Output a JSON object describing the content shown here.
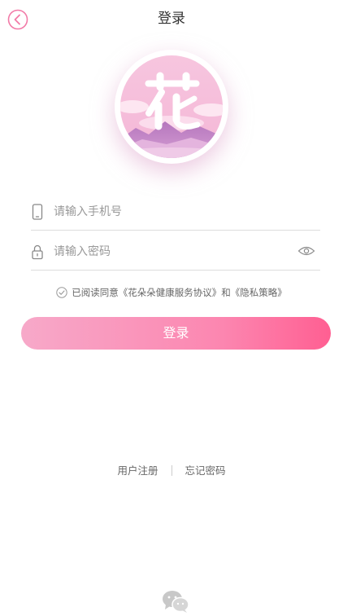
{
  "header": {
    "title": "登录"
  },
  "logo": {
    "text": "花"
  },
  "phone": {
    "placeholder": "请输入手机号",
    "value": ""
  },
  "password": {
    "placeholder": "请输入密码",
    "value": ""
  },
  "agreement": {
    "prefix": "已阅读同意",
    "service_link": "《花朵朵健康服务协议》",
    "conjunction": "和",
    "privacy_link": "《隐私策略》",
    "checked": true
  },
  "login_button": {
    "label": "登录"
  },
  "links": {
    "register": "用户注册",
    "forgot": "忘记密码"
  },
  "icons": {
    "back": "back-icon",
    "phone": "phone-icon",
    "lock": "lock-icon",
    "eye": "eye-icon",
    "check": "check-circle-icon",
    "wechat": "wechat-icon"
  },
  "colors": {
    "accent": "#ff5f92",
    "accent_light": "#f7a9c9",
    "text": "#333333",
    "muted": "#999999"
  }
}
